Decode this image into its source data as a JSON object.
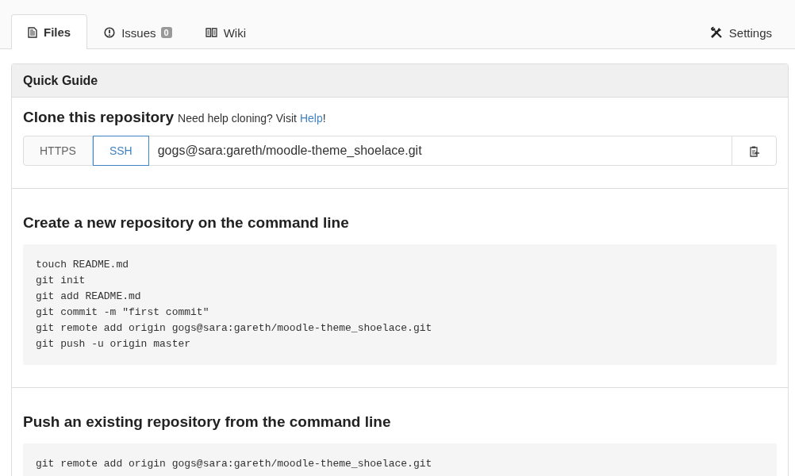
{
  "tabs": [
    {
      "label": "Files",
      "selected": true
    },
    {
      "label": "Issues",
      "count": "0",
      "selected": false
    },
    {
      "label": "Wiki",
      "selected": false
    }
  ],
  "settings": {
    "label": "Settings"
  },
  "guide": {
    "title": "Quick Guide",
    "clone": {
      "heading": "Clone this repository",
      "hint": "Need help cloning? Visit ",
      "link": "Help",
      "hint_end": "!",
      "protocols": [
        {
          "label": "HTTPS",
          "selected": false
        },
        {
          "label": "SSH",
          "selected": true
        }
      ],
      "url": "gogs@sara:gareth/moodle-theme_shoelace.git"
    },
    "sections": [
      {
        "heading": "Create a new repository on the command line",
        "lines": [
          "touch README.md",
          "git init",
          "git add README.md",
          "git commit -m \"first commit\"",
          "git remote add origin gogs@sara:gareth/moodle-theme_shoelace.git",
          "git push -u origin master"
        ]
      },
      {
        "heading": "Push an existing repository from the command line",
        "lines": [
          "git remote add origin gogs@sara:gareth/moodle-theme_shoelace.git"
        ]
      }
    ]
  }
}
